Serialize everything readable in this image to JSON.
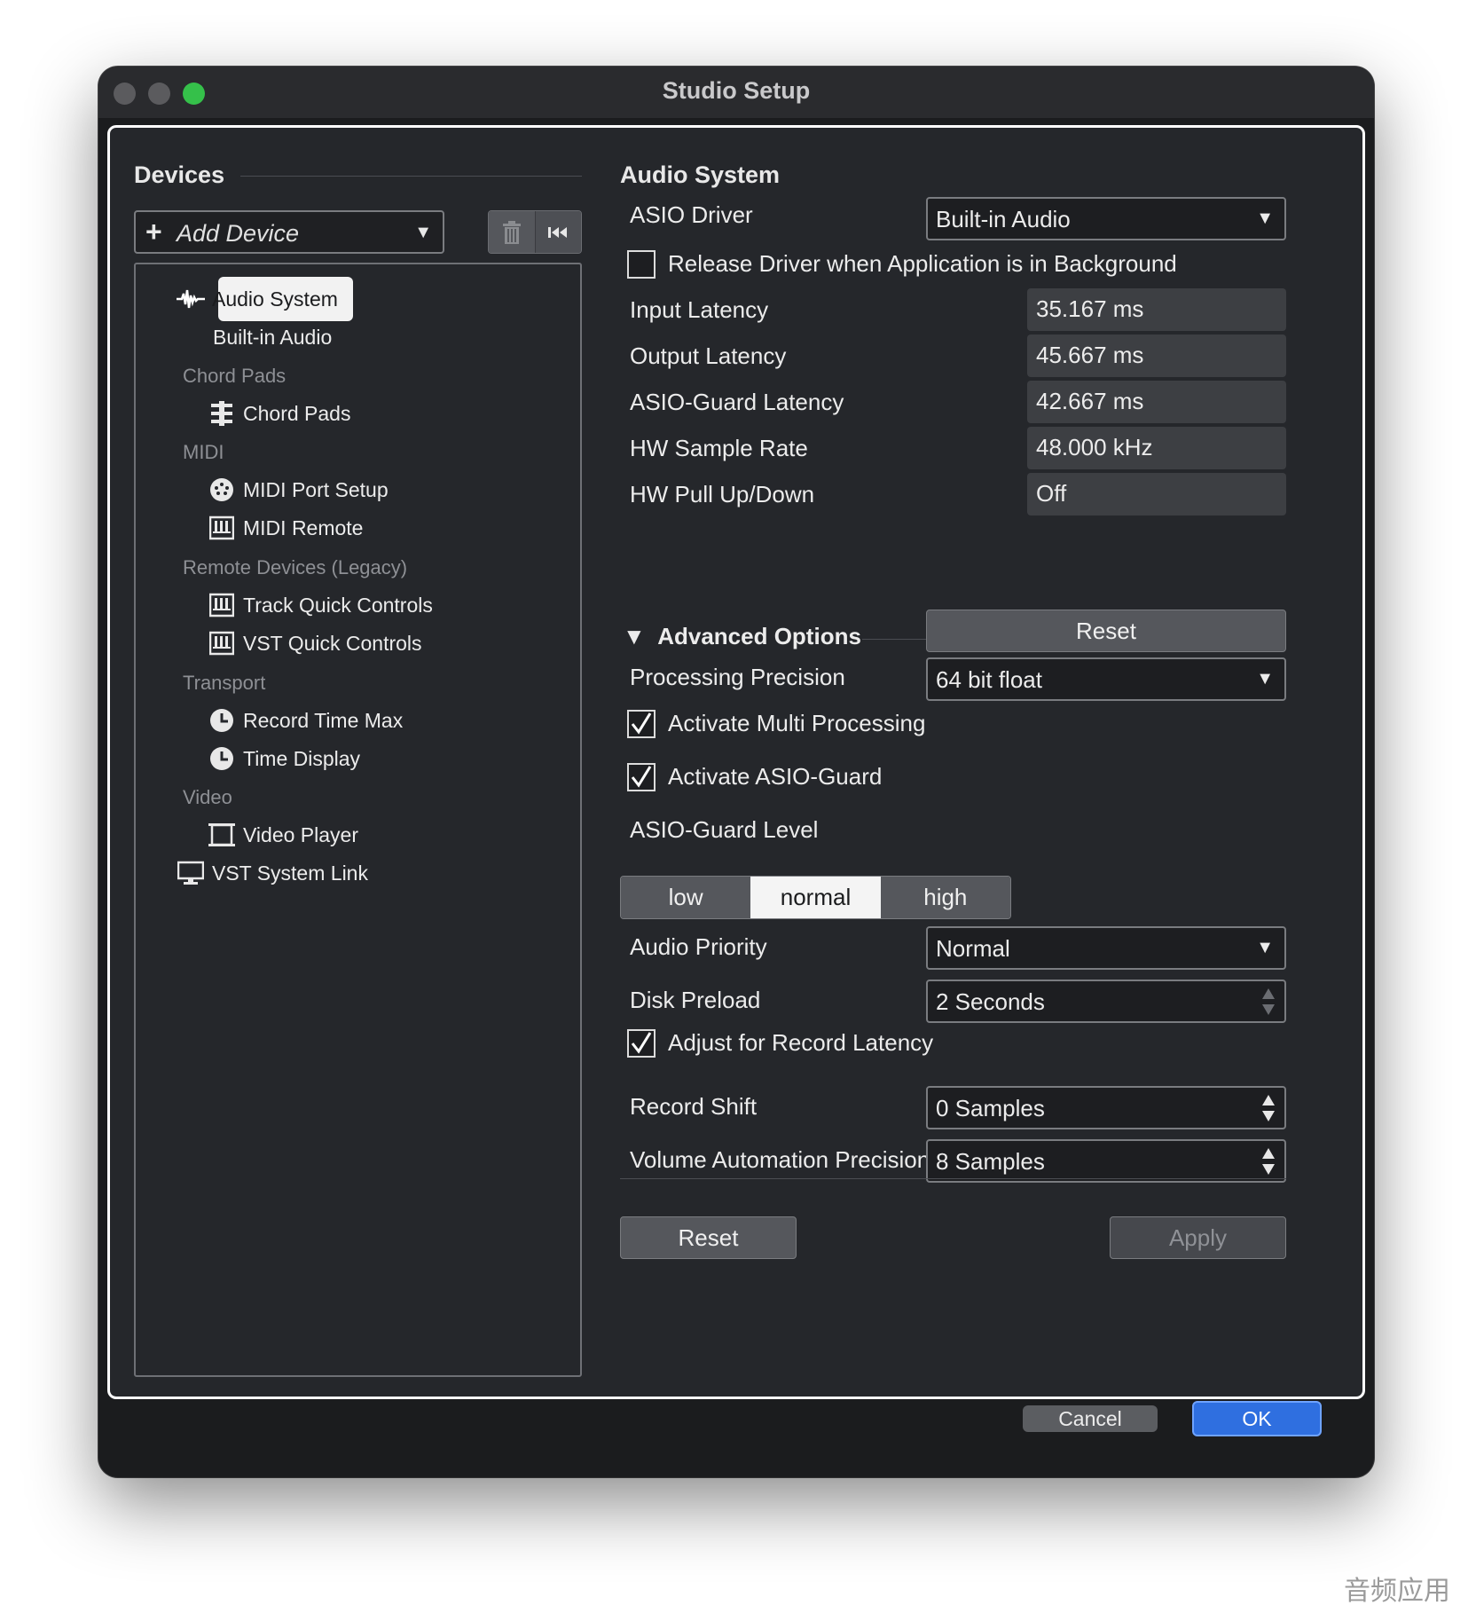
{
  "window": {
    "title": "Studio Setup"
  },
  "devices": {
    "title": "Devices",
    "add_device_label": "Add Device",
    "tree": {
      "audio_system": "Audio System",
      "built_in_audio": "Built-in Audio",
      "group_chord_pads": "Chord Pads",
      "chord_pads": "Chord Pads",
      "group_midi": "MIDI",
      "midi_port_setup": "MIDI Port Setup",
      "midi_remote": "MIDI Remote",
      "group_remote_devices": "Remote Devices (Legacy)",
      "track_quick_controls": "Track Quick Controls",
      "vst_quick_controls": "VST Quick Controls",
      "group_transport": "Transport",
      "record_time_max": "Record Time Max",
      "time_display": "Time Display",
      "group_video": "Video",
      "video_player": "Video Player",
      "vst_system_link": "VST System Link"
    }
  },
  "audio_system": {
    "title": "Audio System",
    "asio_driver_label": "ASIO Driver",
    "asio_driver_value": "Built-in Audio",
    "release_driver_label": "Release Driver when Application is in Background",
    "release_driver_checked": false,
    "input_latency_label": "Input Latency",
    "input_latency_value": "35.167 ms",
    "output_latency_label": "Output Latency",
    "output_latency_value": "45.667 ms",
    "asio_guard_latency_label": "ASIO-Guard Latency",
    "asio_guard_latency_value": "42.667 ms",
    "hw_sample_rate_label": "HW Sample Rate",
    "hw_sample_rate_value": "48.000 kHz",
    "hw_pull_label": "HW Pull Up/Down",
    "hw_pull_value": "Off"
  },
  "advanced": {
    "title": "Advanced Options",
    "reset_label": "Reset",
    "processing_precision_label": "Processing Precision",
    "processing_precision_value": "64 bit float",
    "multi_processing_label": "Activate Multi Processing",
    "multi_processing_checked": true,
    "asio_guard_label": "Activate ASIO-Guard",
    "asio_guard_checked": true,
    "asio_guard_level_label": "ASIO-Guard Level",
    "asio_guard_levels": [
      "low",
      "normal",
      "high"
    ],
    "asio_guard_level_selected": "normal",
    "audio_priority_label": "Audio Priority",
    "audio_priority_value": "Normal",
    "disk_preload_label": "Disk Preload",
    "disk_preload_value": "2 Seconds",
    "adjust_record_latency_label": "Adjust for Record Latency",
    "adjust_record_latency_checked": true,
    "record_shift_label": "Record Shift",
    "record_shift_value": "0 Samples",
    "volume_automation_label": "Volume Automation Precision",
    "volume_automation_value": "8 Samples"
  },
  "panel_buttons": {
    "reset": "Reset",
    "apply": "Apply"
  },
  "footer": {
    "cancel": "Cancel",
    "ok": "OK"
  },
  "watermark": "音频应用",
  "colors": {
    "window_bg": "#1b1c1e",
    "panel_bg": "#25272b",
    "ok_blue": "#2f6fe0",
    "green_light": "#35c04a"
  }
}
